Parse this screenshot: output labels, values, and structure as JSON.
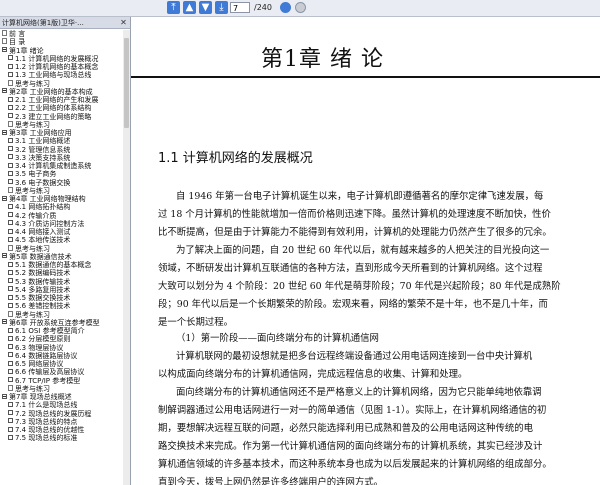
{
  "toolbar": {
    "page_current": "7",
    "page_total": "/240",
    "colors": {
      "accent": "#3f7ad6",
      "toolbar_bg": "#e9ecf2"
    }
  },
  "sidebar": {
    "title": "计算机网络(第1版)卫华·...",
    "close_icon": "close-icon",
    "items": [
      {
        "label": "前 言",
        "type": "page"
      },
      {
        "label": "目 录",
        "type": "page"
      },
      {
        "label": "第1章  绪论",
        "type": "minus"
      },
      {
        "label": "1.1 计算机网络的发展概况",
        "type": "plus",
        "indent": 1
      },
      {
        "label": "1.2 计算机网络的基本概念",
        "type": "plus",
        "indent": 1
      },
      {
        "label": "1.3 工业网络与现场总线",
        "type": "plus",
        "indent": 1
      },
      {
        "label": "思考与练习",
        "type": "page",
        "indent": 1
      },
      {
        "label": "第2章  工业网络的基本构成",
        "type": "minus"
      },
      {
        "label": "2.1 工业网络的产生和发展",
        "type": "plus",
        "indent": 1
      },
      {
        "label": "2.2 工业网络的体系结构",
        "type": "plus",
        "indent": 1
      },
      {
        "label": "2.3 建立工业网络的策略",
        "type": "plus",
        "indent": 1
      },
      {
        "label": "思考与练习",
        "type": "page",
        "indent": 1
      },
      {
        "label": "第3章  工业网络应用",
        "type": "minus"
      },
      {
        "label": "3.1 工业网络概述",
        "type": "plus",
        "indent": 1
      },
      {
        "label": "3.2 管理信息系统",
        "type": "plus",
        "indent": 1
      },
      {
        "label": "3.3 决策支持系统",
        "type": "plus",
        "indent": 1
      },
      {
        "label": "3.4 计算机集成制造系统",
        "type": "plus",
        "indent": 1
      },
      {
        "label": "3.5 电子商务",
        "type": "plus",
        "indent": 1
      },
      {
        "label": "3.6 电子数据交换",
        "type": "plus",
        "indent": 1
      },
      {
        "label": "思考与练习",
        "type": "page",
        "indent": 1
      },
      {
        "label": "第4章  工业网络物理结构",
        "type": "minus"
      },
      {
        "label": "4.1 网络拓扑结构",
        "type": "plus",
        "indent": 1
      },
      {
        "label": "4.2 传输介质",
        "type": "plus",
        "indent": 1
      },
      {
        "label": "4.3 介质访问控制方法",
        "type": "plus",
        "indent": 1
      },
      {
        "label": "4.4 网络接入测试",
        "type": "plus",
        "indent": 1
      },
      {
        "label": "4.5 本地传送技术",
        "type": "plus",
        "indent": 1
      },
      {
        "label": "思考与练习",
        "type": "page",
        "indent": 1
      },
      {
        "label": "第5章  数据通信技术",
        "type": "minus"
      },
      {
        "label": "5.1 数据通信的基本概念",
        "type": "plus",
        "indent": 1
      },
      {
        "label": "5.2 数据编码技术",
        "type": "plus",
        "indent": 1
      },
      {
        "label": "5.3 数据传输技术",
        "type": "plus",
        "indent": 1
      },
      {
        "label": "5.4 多路复用技术",
        "type": "plus",
        "indent": 1
      },
      {
        "label": "5.5 数据交换技术",
        "type": "plus",
        "indent": 1
      },
      {
        "label": "5.6 差错控制技术",
        "type": "plus",
        "indent": 1
      },
      {
        "label": "思考与练习",
        "type": "page",
        "indent": 1
      },
      {
        "label": "第6章  开放系统互连参考模型",
        "type": "minus"
      },
      {
        "label": "6.1 OSI 参考模型简介",
        "type": "plus",
        "indent": 1
      },
      {
        "label": "6.2 分层模型原则",
        "type": "plus",
        "indent": 1
      },
      {
        "label": "6.3 物理层协议",
        "type": "plus",
        "indent": 1
      },
      {
        "label": "6.4 数据链路层协议",
        "type": "plus",
        "indent": 1
      },
      {
        "label": "6.5 网络层协议",
        "type": "plus",
        "indent": 1
      },
      {
        "label": "6.6 传输层及高层协议",
        "type": "plus",
        "indent": 1
      },
      {
        "label": "6.7 TCP/IP 参考模型",
        "type": "plus",
        "indent": 1
      },
      {
        "label": "思考与练习",
        "type": "page",
        "indent": 1
      },
      {
        "label": "第7章  现场总线概述",
        "type": "minus"
      },
      {
        "label": "7.1 什么是现场总线",
        "type": "plus",
        "indent": 1
      },
      {
        "label": "7.2 现场总线的发展历程",
        "type": "plus",
        "indent": 1
      },
      {
        "label": "7.3 现场总线的特点",
        "type": "plus",
        "indent": 1
      },
      {
        "label": "7.4 现场总线的优越性",
        "type": "plus",
        "indent": 1
      },
      {
        "label": "7.5 现场总线的标准",
        "type": "plus",
        "indent": 1
      }
    ]
  },
  "document": {
    "chapter_title": "第1章   绪    论",
    "section_title": "1.1  计算机网络的发展概况",
    "paragraphs": [
      "自 1946 年第一台电子计算机诞生以来，电子计算机即遵循著名的摩尔定律飞速发展，每",
      "过 18 个月计算机的性能就增加一倍而价格则迅速下降。虽然计算机的处理速度不断加快，性价",
      "比不断提高，但是由于计算能力不能得到有效利用，计算机的处理能力仍然产生了很多的冗余。",
      "为了解决上面的问题，自 20 世纪 60 年代以后，就有越来越多的人把关注的目光投向这一",
      "领域，不断研发出计算机互联通信的各种方法，直到形成今天所看到的计算机网络。这个过程",
      "大致可以划分为 4 个阶段：20 世纪 60 年代是萌芽阶段；70 年代是兴起阶段；80 年代是成熟阶",
      "段；90 年代以后是一个长期繁荣的阶段。宏观来看，网络的繁荣不是十年，也不是几十年，而",
      "是一个长期过程。",
      "（1）第一阶段——面向终端分布的计算机通信网",
      "计算机联网的最初设想就是把多台远程终端设备通过公用电话网连接到一台中央计算机",
      "以构成面向终端分布的计算机通信网，完成远程信息的收集、计算和处理。",
      "面向终端分布的计算机通信网还不是严格意义上的计算机网络，因为它只能单纯地依靠调",
      "制解调器通过公用电话网进行一对一的简单通信（见图 1-1）。实际上，在计算机网络通信的初",
      "期，要想解决远程互联的问题，必然只能选择利用已成熟和普及的公用电话网这种传统的电",
      "路交换技术来完成。作为第一代计算机通信网的面向终端分布的计算机系统，其实已经涉及计",
      "算机通信领域的许多基本技术，而这种系统本身也成为以后发展起来的计算机网络的组成部分。",
      "直到今天，拨号上网仍然是许多终端用户的连网方式。"
    ]
  }
}
